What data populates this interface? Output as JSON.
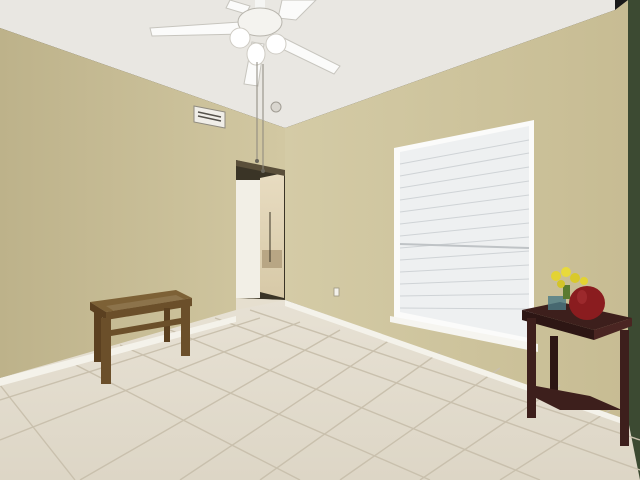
{
  "scene": {
    "kind": "interior-photo",
    "room": "empty bedroom",
    "colors": {
      "wall": "#cdc39c",
      "wall_shadow": "#b9ae86",
      "ceiling": "#e9e7e2",
      "floor_tile": "#e3ddd0",
      "grout": "#c9c0ad",
      "baseboard": "#f4f2ea",
      "window_light": "#f2f3f4",
      "wood_bench": "#6b4f2a",
      "dark_table": "#3d1f1c",
      "vase": "#8a1c1f",
      "flowers": "#e3d332"
    }
  }
}
